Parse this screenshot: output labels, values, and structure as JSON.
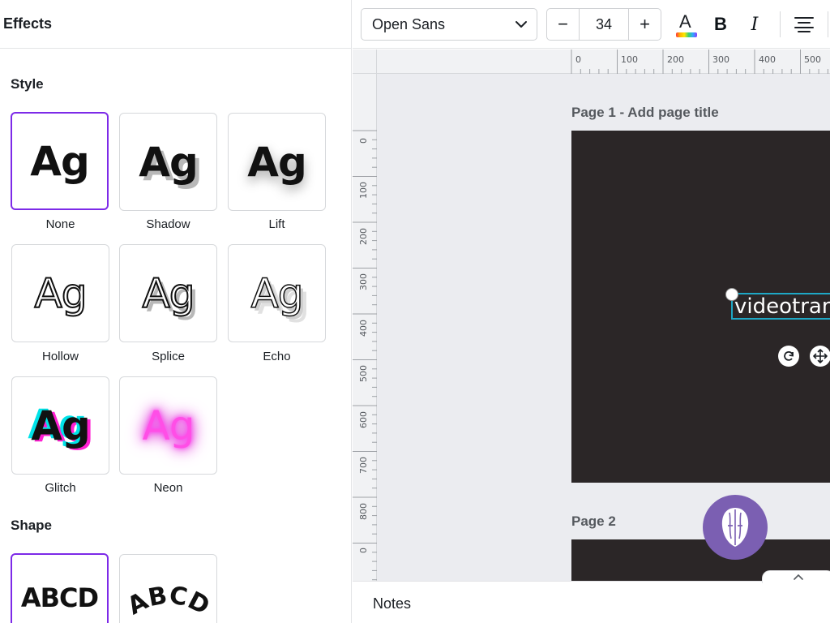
{
  "panel": {
    "title": "Effects",
    "style_section": "Style",
    "shape_section": "Shape",
    "effects": [
      {
        "label": "None",
        "preview": "Ag",
        "selected": true
      },
      {
        "label": "Shadow",
        "preview": "Ag",
        "selected": false
      },
      {
        "label": "Lift",
        "preview": "Ag",
        "selected": false
      },
      {
        "label": "Hollow",
        "preview": "Ag",
        "selected": false
      },
      {
        "label": "Splice",
        "preview": "Ag",
        "selected": false
      },
      {
        "label": "Echo",
        "preview": "Ag",
        "selected": false
      },
      {
        "label": "Glitch",
        "preview": "Ag",
        "selected": false
      },
      {
        "label": "Neon",
        "preview": "Ag",
        "selected": false
      }
    ],
    "shapes": [
      {
        "preview": "ABCD",
        "selected": true
      },
      {
        "preview": "ABCD",
        "selected": false
      }
    ]
  },
  "toolbar": {
    "font_family": "Open Sans",
    "font_size": "34",
    "minus_label": "−",
    "plus_label": "+",
    "text_color_glyph": "A",
    "bold_glyph": "B",
    "italic_glyph": "I"
  },
  "rulers": {
    "top": [
      "0",
      "100",
      "200",
      "300",
      "400",
      "500"
    ],
    "left": [
      "0",
      "100",
      "200",
      "300",
      "400",
      "500",
      "600",
      "700",
      "800",
      "0"
    ]
  },
  "pages": [
    {
      "title": "Page 1",
      "separator": " - ",
      "title_placeholder": "Add page title"
    },
    {
      "title": "Page 2"
    }
  ],
  "canvas_text": "videotranscript",
  "notes": {
    "label": "Notes"
  },
  "colors": {
    "accent": "#7d2ae8",
    "selection": "#1ea7c5",
    "page_background": "#2b2627",
    "avatar": "#7b5fb2"
  }
}
